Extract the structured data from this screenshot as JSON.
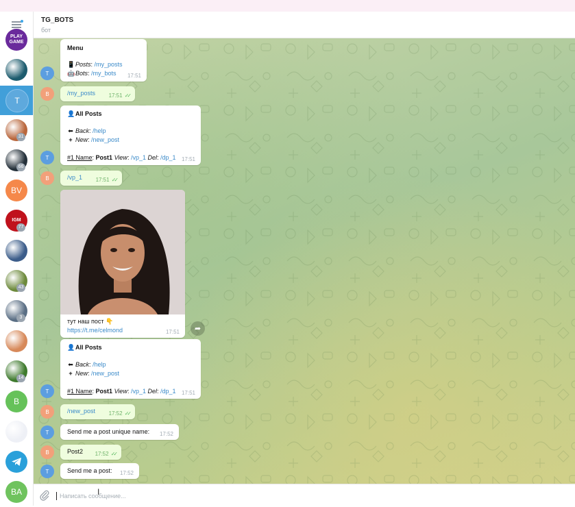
{
  "header": {
    "title": "TG_BOTS",
    "subtitle": "бот"
  },
  "sidebar": {
    "menu_icon": "hamburger-menu-icon",
    "chats": [
      {
        "initials": "PLAY GAME",
        "color": "#6a2a9c",
        "kind": "logo"
      },
      {
        "initials": "",
        "color": "#1d5c6e",
        "kind": "image"
      },
      {
        "initials": "T",
        "color": "#5ea9dd",
        "kind": "letter",
        "active": true
      },
      {
        "initials": "",
        "color": "#b9673d",
        "kind": "image",
        "count": "31"
      },
      {
        "initials": "",
        "color": "#24303a",
        "kind": "image",
        "count": "66"
      },
      {
        "initials": "BV",
        "color": "#f5884a",
        "kind": "letter"
      },
      {
        "initials": "IGM",
        "color": "#c0121c",
        "kind": "logo",
        "count": "77"
      },
      {
        "initials": "",
        "color": "#3c5d8a",
        "kind": "image"
      },
      {
        "initials": "",
        "color": "#6d8a3c",
        "kind": "image",
        "count": "43"
      },
      {
        "initials": "",
        "color": "#5a6e84",
        "kind": "image",
        "count": "3"
      },
      {
        "initials": "",
        "color": "#d7895a",
        "kind": "image"
      },
      {
        "initials": "",
        "color": "#3e7a2d",
        "kind": "image",
        "count": "14"
      },
      {
        "initials": "B",
        "color": "#66c25a",
        "kind": "letter"
      },
      {
        "initials": "",
        "color": "#eef0f6",
        "kind": "image"
      },
      {
        "initials": "",
        "color": "#2aa0da",
        "kind": "telegram"
      },
      {
        "initials": "BA",
        "color": "#6fc35e",
        "kind": "letter"
      }
    ]
  },
  "avatars": {
    "bot": "T",
    "user": "B",
    "bot_color": "#5c9ee0",
    "user_color": "#f2a07a"
  },
  "messages": {
    "m1": {
      "title": "Menu",
      "l1_icon": "📱",
      "l1_label": "Posts",
      "l1_cmd": "/my_posts",
      "l2_icon": "🤖",
      "l2_label": "Bots",
      "l2_cmd": "/my_bots",
      "time": "17:51"
    },
    "m2": {
      "text": "/my_posts",
      "time": "17:51"
    },
    "m3": {
      "title": "All Posts",
      "back_label": "Back",
      "back_cmd": "/help",
      "new_label": "New",
      "new_cmd": "/new_post",
      "row_num": "#1 Name",
      "row_name": "Post1",
      "row_view_label": "View",
      "row_view_cmd": "/vp_1",
      "row_del_label": "Del",
      "row_del_cmd": "/dp_1",
      "time": "17:51"
    },
    "m4": {
      "text": "/vp_1",
      "time": "17:51"
    },
    "m5": {
      "caption": "тут наш пост 👇",
      "link": "https://t.me/celmond",
      "time": "17:51"
    },
    "m6": {
      "title": "All Posts",
      "back_label": "Back",
      "back_cmd": "/help",
      "new_label": "New",
      "new_cmd": "/new_post",
      "row_num": "#1 Name",
      "row_name": "Post1",
      "row_view_label": "View",
      "row_view_cmd": "/vp_1",
      "row_del_label": "Del",
      "row_del_cmd": "/dp_1",
      "time": "17:51"
    },
    "m7": {
      "text": "/new_post",
      "time": "17:52"
    },
    "m8": {
      "text": "Send me a post unique name:",
      "time": "17:52"
    },
    "m9": {
      "text": "Post2",
      "time": "17:52"
    },
    "m10": {
      "text": "Send me a post:",
      "time": "17:52"
    }
  },
  "input": {
    "placeholder": "Написать сообщение..."
  },
  "colors": {
    "accent": "#419fd9",
    "outgoing_bubble": "#effdde",
    "link": "#3a8ac9",
    "read_ticks": "#5dbb63"
  }
}
